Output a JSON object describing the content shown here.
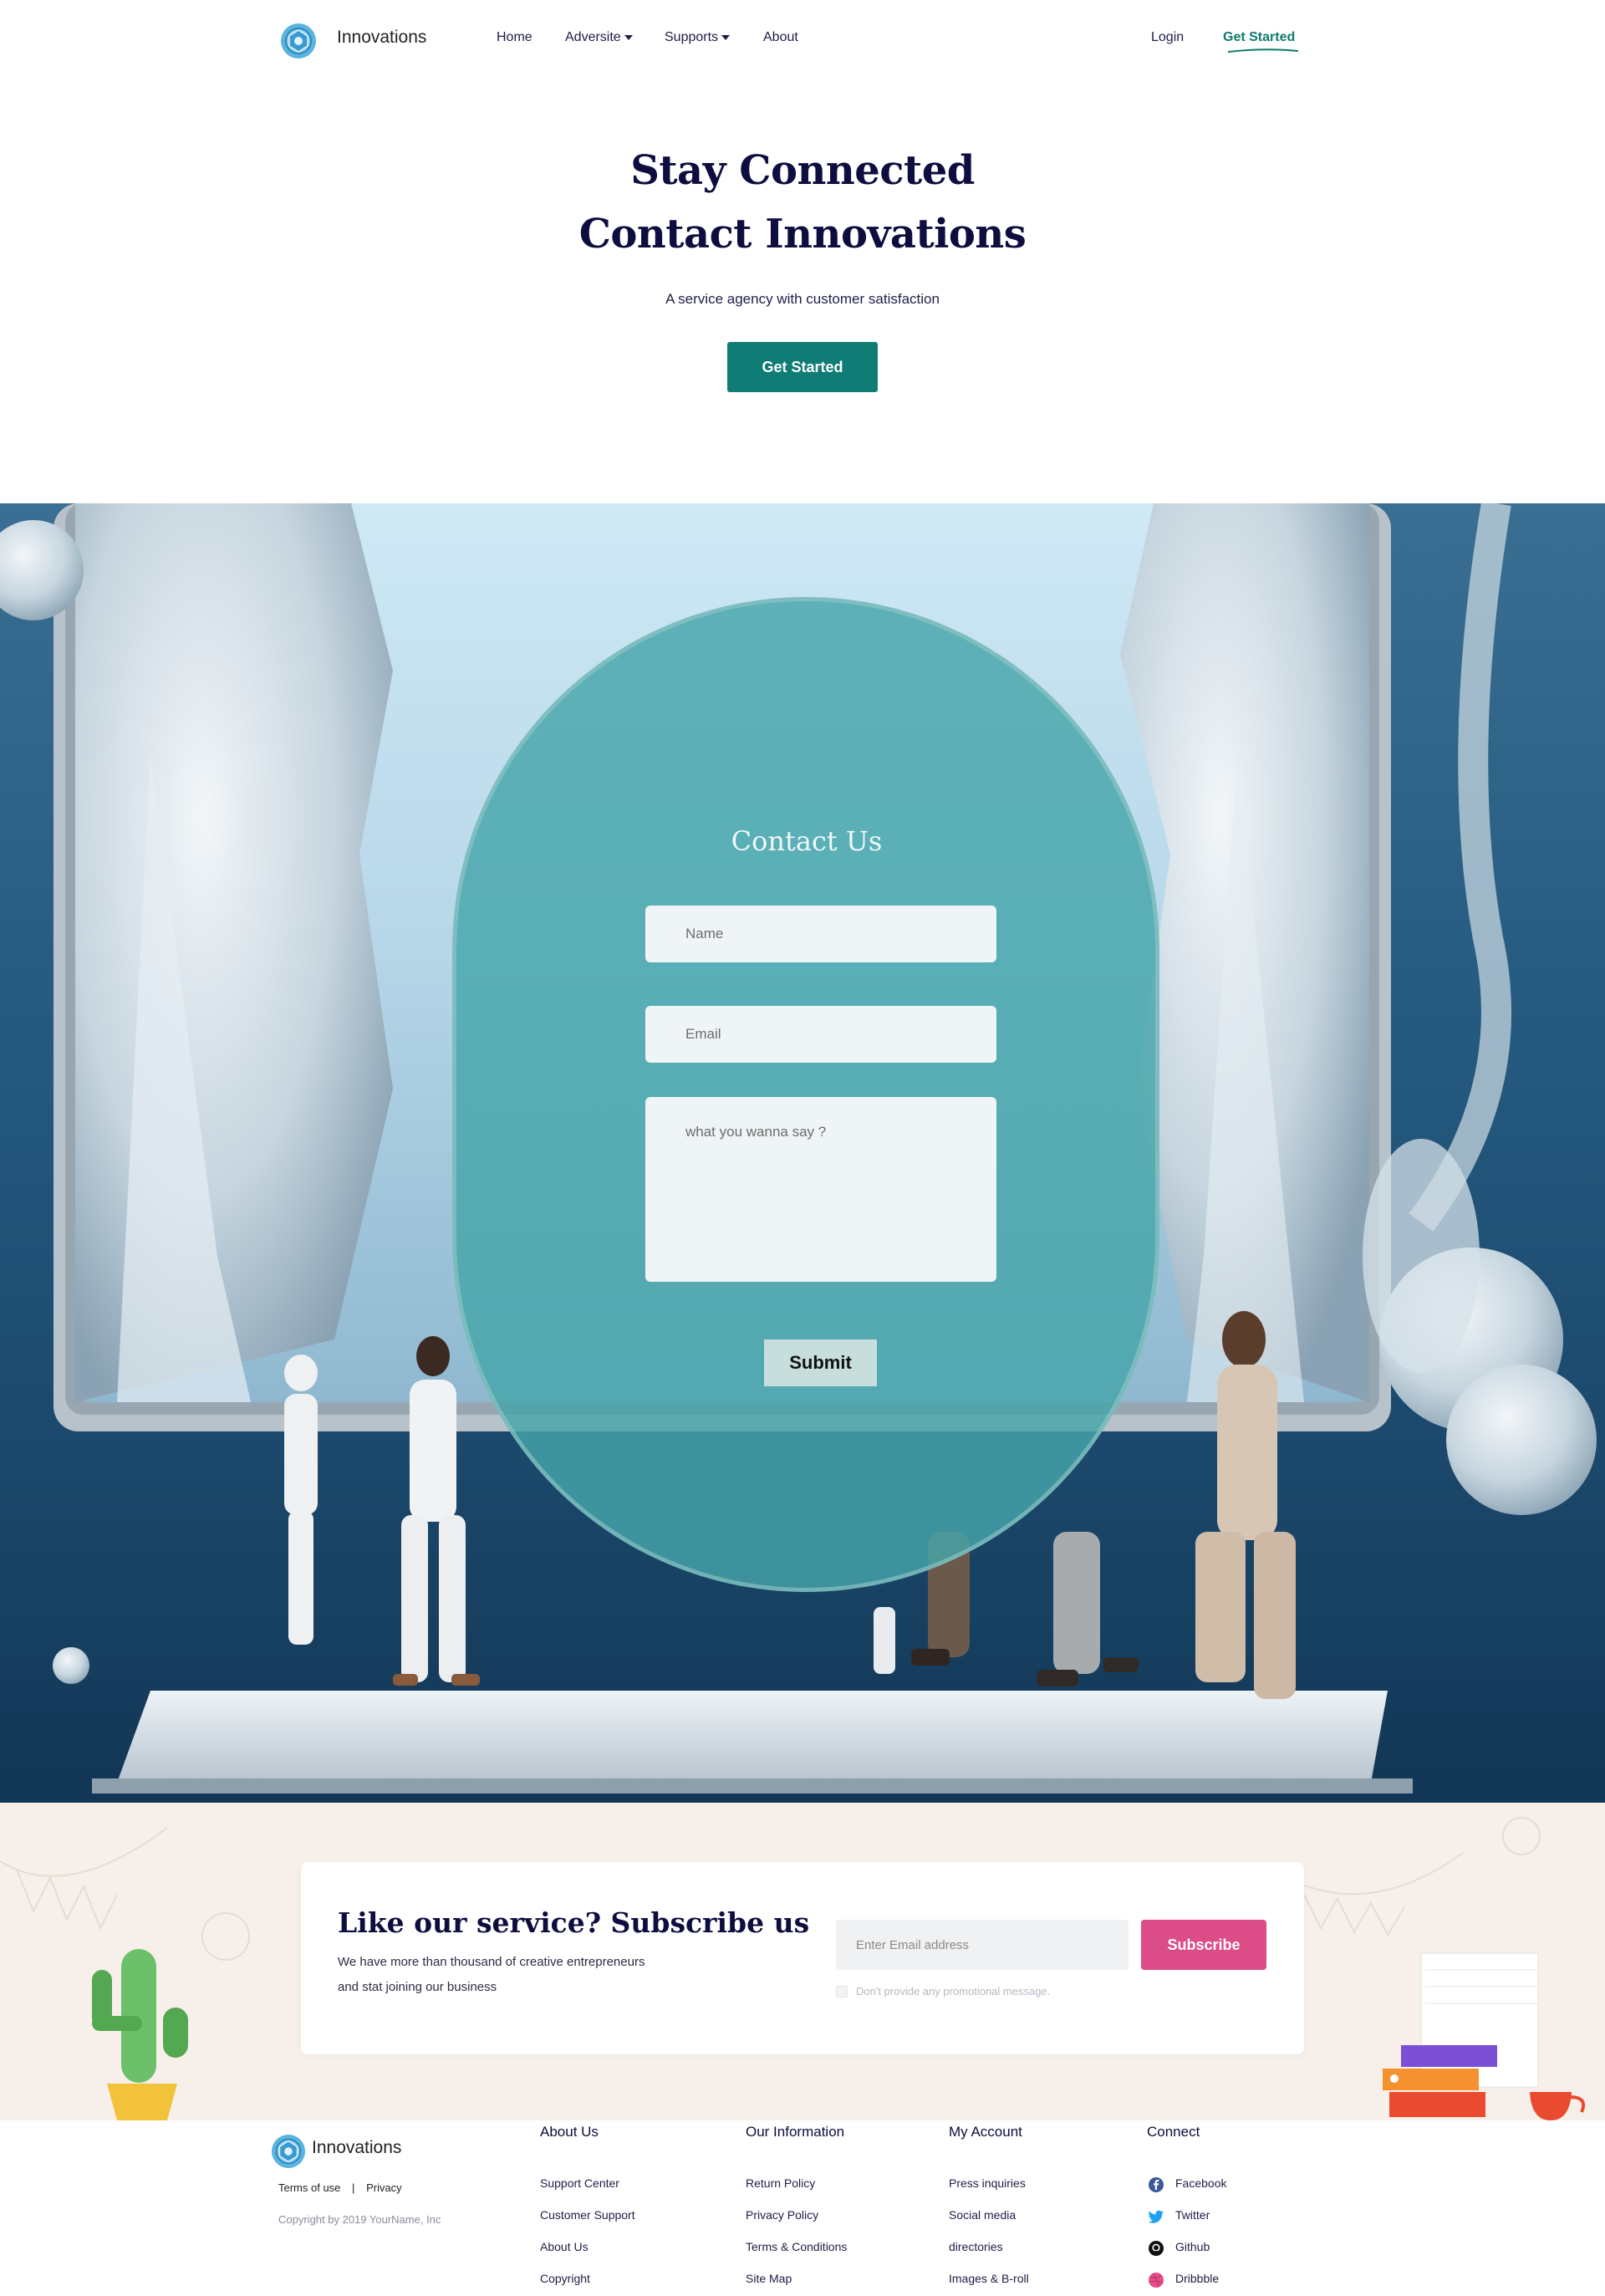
{
  "nav": {
    "brand": "Innovations",
    "links": [
      {
        "label": "Home",
        "dropdown": false
      },
      {
        "label": "Adversite",
        "dropdown": true
      },
      {
        "label": "Supports",
        "dropdown": true
      },
      {
        "label": "About",
        "dropdown": false
      }
    ],
    "login": "Login",
    "cta": "Get Started"
  },
  "hero": {
    "title_line1": "Stay Connected",
    "title_line2": "Contact Innovations",
    "subtitle": "A service agency with customer satisfaction",
    "button": "Get Started"
  },
  "contact": {
    "title": "Contact Us",
    "name_placeholder": "Name",
    "email_placeholder": "Email",
    "message_placeholder": "what you wanna say ?",
    "submit": "Submit"
  },
  "subscribe": {
    "title": "Like our service? Subscribe us",
    "desc_line1": "We have more than thousand of creative entrepreneurs",
    "desc_line2": "and stat joining our business",
    "input_placeholder": "Enter Email address",
    "button": "Subscribe",
    "checkbox_label": "Don't provide any promotional message."
  },
  "footer": {
    "brand": "Innovations",
    "terms": "Terms of use",
    "separator": "|",
    "privacy": "Privacy",
    "copyright": "Copyright by 2019 YourName, Inc",
    "columns": [
      {
        "title": "About Us",
        "links": [
          "Support Center",
          "Customer Support",
          "About Us",
          "Copyright"
        ]
      },
      {
        "title": "Our Information",
        "links": [
          "Return Policy",
          "Privacy Policy",
          "Terms & Conditions",
          "Site Map"
        ]
      },
      {
        "title": "My Account",
        "links": [
          "Press inquiries",
          "Social media",
          "directories",
          "Images & B-roll"
        ]
      },
      {
        "title": "Connect",
        "links": [
          "Facebook",
          "Twitter",
          "Github",
          "Dribbble"
        ]
      }
    ],
    "social_icons": [
      "facebook-icon",
      "twitter-icon",
      "github-icon",
      "dribbble-icon"
    ]
  },
  "colors": {
    "primary": "#0f7c75",
    "heading": "#0d0d3f",
    "subscribe_button": "#dc4d87",
    "subscribe_band": "#f7f0ea",
    "form_panel": "#46a5aa"
  }
}
